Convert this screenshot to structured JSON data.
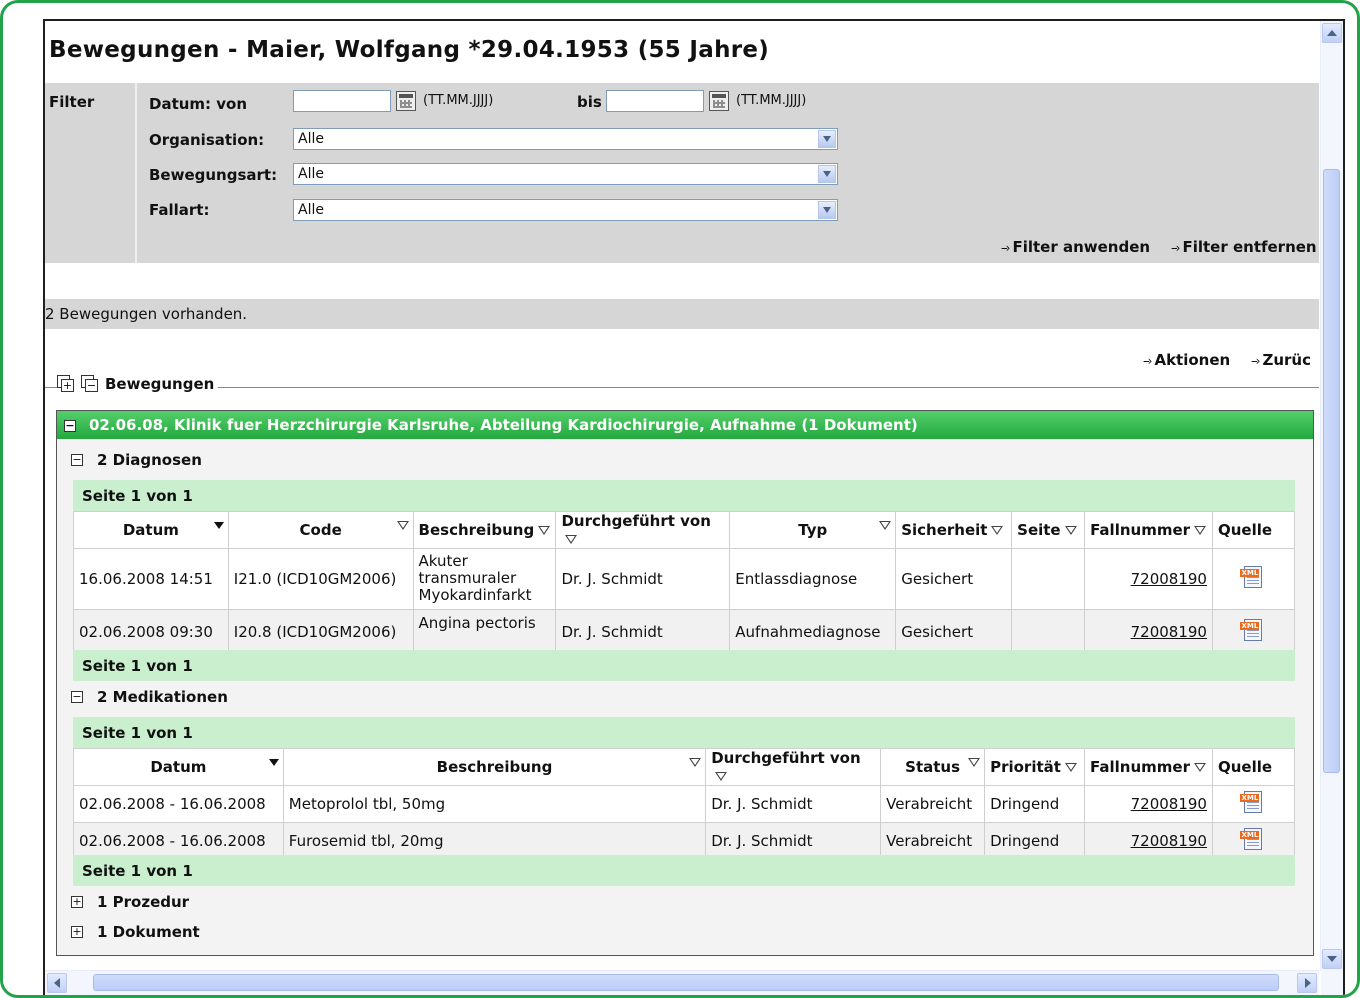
{
  "page": {
    "title": "Bewegungen - Maier, Wolfgang *29.04.1953 (55 Jahre)"
  },
  "filter": {
    "label": "Filter",
    "datum_von_label": "Datum:  von",
    "von_value": "",
    "hint": "(TT.MM.JJJJ)",
    "bis_label": "bis",
    "bis_value": "",
    "organisation_label": "Organisation:",
    "organisation_value": "Alle",
    "bewegungsart_label": "Bewegungsart:",
    "bewegungsart_value": "Alle",
    "fallart_label": "Fallart:",
    "fallart_value": "Alle",
    "apply": "Filter anwenden",
    "remove": "Filter entfernen"
  },
  "info": {
    "count": "2 Bewegungen vorhanden."
  },
  "actions": {
    "aktionen": "Aktionen",
    "zurueck": "Zurüc"
  },
  "group": {
    "legend": "Bewegungen"
  },
  "movement": {
    "header": "02.06.08, Klinik fuer Herzchirurgie Karlsruhe, Abteilung Kardiochirurgie, Aufnahme (1 Dokument)"
  },
  "diagnosen": {
    "title": "2 Diagnosen",
    "page": "Seite 1 von 1",
    "columns": [
      "Datum",
      "Code",
      "Beschreibung",
      "Durchgeführt von",
      "Typ",
      "Sicherheit",
      "Seite",
      "Fallnummer",
      "Quelle"
    ],
    "rows": [
      {
        "datum": "16.06.2008 14:51",
        "code": "I21.0 (ICD10GM2006)",
        "beschreibung": "Akuter transmuraler Myokardinfarkt",
        "von": "Dr. J. Schmidt",
        "typ": "Entlassdiagnose",
        "sicherheit": "Gesichert",
        "seite": "",
        "fall": "72008190"
      },
      {
        "datum": "02.06.2008 09:30",
        "code": "I20.8 (ICD10GM2006)",
        "beschreibung": "Angina pectoris",
        "von": "Dr. J. Schmidt",
        "typ": "Aufnahmediagnose",
        "sicherheit": "Gesichert",
        "seite": "",
        "fall": "72008190"
      }
    ]
  },
  "medikationen": {
    "title": "2 Medikationen",
    "page": "Seite 1 von 1",
    "columns": [
      "Datum",
      "Beschreibung",
      "Durchgeführt von",
      "Status",
      "Priorität",
      "Fallnummer",
      "Quelle"
    ],
    "rows": [
      {
        "datum": "02.06.2008 - 16.06.2008",
        "beschreibung": "Metoprolol tbl, 50mg",
        "von": "Dr. J. Schmidt",
        "status": "Verabreicht",
        "prio": "Dringend",
        "fall": "72008190"
      },
      {
        "datum": "02.06.2008 - 16.06.2008",
        "beschreibung": "Furosemid tbl, 20mg",
        "von": "Dr. J. Schmidt",
        "status": "Verabreicht",
        "prio": "Dringend",
        "fall": "72008190"
      }
    ]
  },
  "prozedur": {
    "title": "1 Prozedur"
  },
  "dokument": {
    "title": "1 Dokument"
  },
  "icons": {
    "xml": "XML"
  }
}
